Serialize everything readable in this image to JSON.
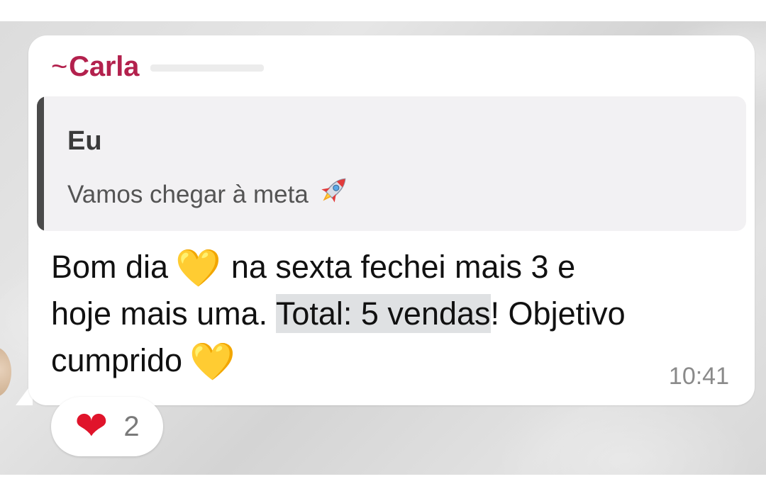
{
  "message": {
    "sender": "Carla",
    "sender_prefix": "~",
    "quoted": {
      "author": "Eu",
      "text": "Vamos chegar à meta",
      "emoji": "rocket-icon"
    },
    "body": {
      "line1_a": "Bom dia",
      "line1_b": "na sexta fechei mais 3 e",
      "line2_a": "hoje mais uma. ",
      "line2_highlight": "Total: 5 vendas",
      "line2_b": "! Objetivo",
      "line3_a": "cumprido",
      "heart_emoji": "💛"
    },
    "time": "10:41"
  },
  "reaction": {
    "emoji": "❤",
    "count": "2"
  },
  "colors": {
    "sender": "#b3214d",
    "quote_bar": "#4a4a4a",
    "highlight": "#dfe1e3",
    "heart_yellow": "#f5c518",
    "heart_red": "#e0142b"
  }
}
